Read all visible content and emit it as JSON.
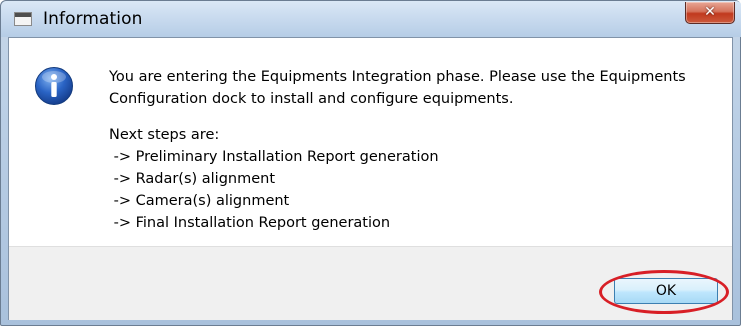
{
  "window": {
    "title": "Information"
  },
  "icons": {
    "app": "window-app-icon",
    "close": "close-icon",
    "info": "information-icon"
  },
  "close_glyph": "✕",
  "message": {
    "line1": "You are entering the Equipments Integration phase. Please use the Equipments",
    "line2": "Configuration dock to install and configure equipments.",
    "steps_heading": "Next steps are:",
    "steps": [
      " -> Preliminary Installation Report generation",
      " -> Radar(s) alignment",
      " -> Camera(s) alignment",
      " -> Final Installation Report generation"
    ]
  },
  "buttons": {
    "ok_label": "OK"
  },
  "colors": {
    "highlight": "#d81f26",
    "info_icon_blue": "#2a64c5",
    "close_red": "#c1391e"
  }
}
